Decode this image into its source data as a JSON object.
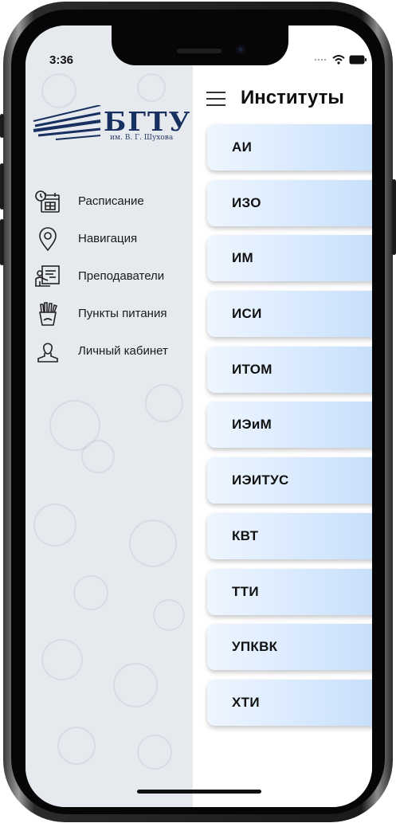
{
  "status_bar": {
    "time": "3:36"
  },
  "drawer": {
    "logo": {
      "title": "БГТУ",
      "subtitle": "им. В. Г. Шухова"
    },
    "items": [
      {
        "label": "Расписание",
        "icon": "calendar-clock-icon"
      },
      {
        "label": "Навигация",
        "icon": "map-pin-icon"
      },
      {
        "label": "Преподаватели",
        "icon": "teacher-board-icon"
      },
      {
        "label": "Пункты питания",
        "icon": "food-icon"
      },
      {
        "label": "Личный кабинет",
        "icon": "user-icon"
      }
    ]
  },
  "header": {
    "title": "Институты",
    "menu_icon": "hamburger-icon"
  },
  "institutes": [
    "АИ",
    "ИЗО",
    "ИМ",
    "ИСИ",
    "ИТОМ",
    "ИЭиМ",
    "ИЭИТУС",
    "КВТ",
    "ТТИ",
    "УПКВК",
    "ХТИ"
  ],
  "colors": {
    "card_start": "#eef6ff",
    "card_end": "#c2dcf9",
    "logo": "#17305f",
    "drawer_bg": "#e6e9ee"
  }
}
